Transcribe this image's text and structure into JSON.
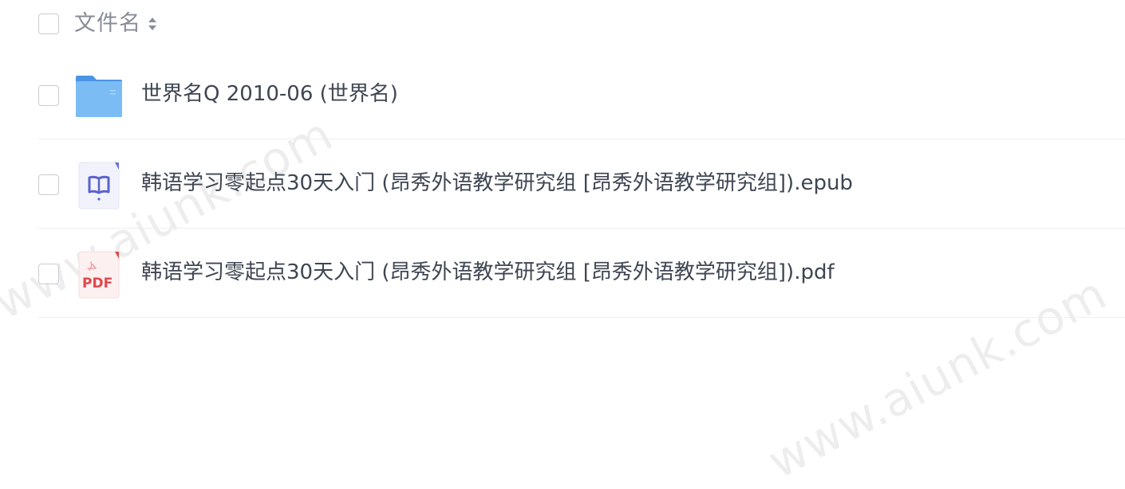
{
  "header": {
    "label": "文件名",
    "sort_icon": "sort-arrows-icon"
  },
  "files": [
    {
      "name": "世界名Q 2010-06 (世界名)",
      "type": "folder",
      "icon": "folder-icon"
    },
    {
      "name": "韩语学习零起点30天入门 (昂秀外语教学研究组 [昂秀外语教学研究组]).epub",
      "type": "epub",
      "icon": "epub-icon"
    },
    {
      "name": "韩语学习零起点30天入门 (昂秀外语教学研究组 [昂秀外语教学研究组]).pdf",
      "type": "pdf",
      "icon": "pdf-icon",
      "icon_label": "PDF"
    }
  ],
  "watermark": "www.aiunk.com",
  "colors": {
    "folder": "#5ea8f0",
    "epub": "#6b73d6",
    "pdf": "#e0474c",
    "divider": "#eceef1"
  }
}
